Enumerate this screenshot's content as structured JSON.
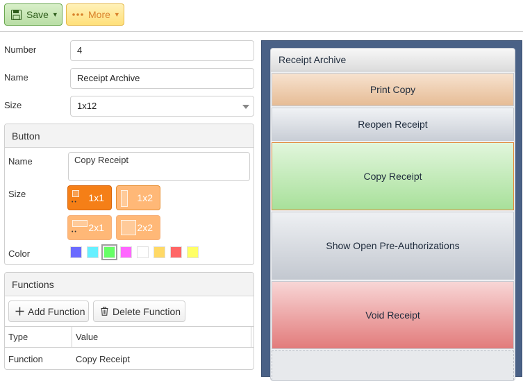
{
  "toolbar": {
    "save_label": "Save",
    "more_label": "More"
  },
  "form": {
    "number_label": "Number",
    "number_value": "4",
    "name_label": "Name",
    "name_value": "Receipt Archive",
    "size_label": "Size",
    "size_value": "1x12"
  },
  "button_panel": {
    "title": "Button",
    "name_label": "Name",
    "name_value": "Copy Receipt",
    "size_label": "Size",
    "sizes": [
      {
        "label": "1x1",
        "selected": true
      },
      {
        "label": "1x2",
        "selected": false
      },
      {
        "label": "2x1",
        "selected": false
      },
      {
        "label": "2x2",
        "selected": false
      }
    ],
    "color_label": "Color",
    "colors": [
      "#6b6bff",
      "#66f0ff",
      "#66ff66",
      "#ff66ff",
      "#ffffff",
      "#ffd966",
      "#ff6666",
      "#ffff66"
    ],
    "selected_color": "#66ff66"
  },
  "functions_panel": {
    "title": "Functions",
    "add_label": "Add Function",
    "delete_label": "Delete Function",
    "columns": [
      "Type",
      "Value"
    ],
    "rows": [
      {
        "type": "Function",
        "value": "Copy Receipt"
      }
    ]
  },
  "preview": {
    "title": "Receipt Archive",
    "buttons": [
      {
        "label": "Print Copy"
      },
      {
        "label": "Reopen Receipt"
      },
      {
        "label": "Copy Receipt"
      },
      {
        "label": "Show Open Pre-Authorizations"
      },
      {
        "label": "Void Receipt"
      }
    ]
  },
  "colors": {
    "save_accent": "#6aa84f",
    "more_accent": "#e5b84a",
    "size_selected": "#f57f17",
    "size_unselected": "#ffb877",
    "preview_background": "#4a6186"
  }
}
